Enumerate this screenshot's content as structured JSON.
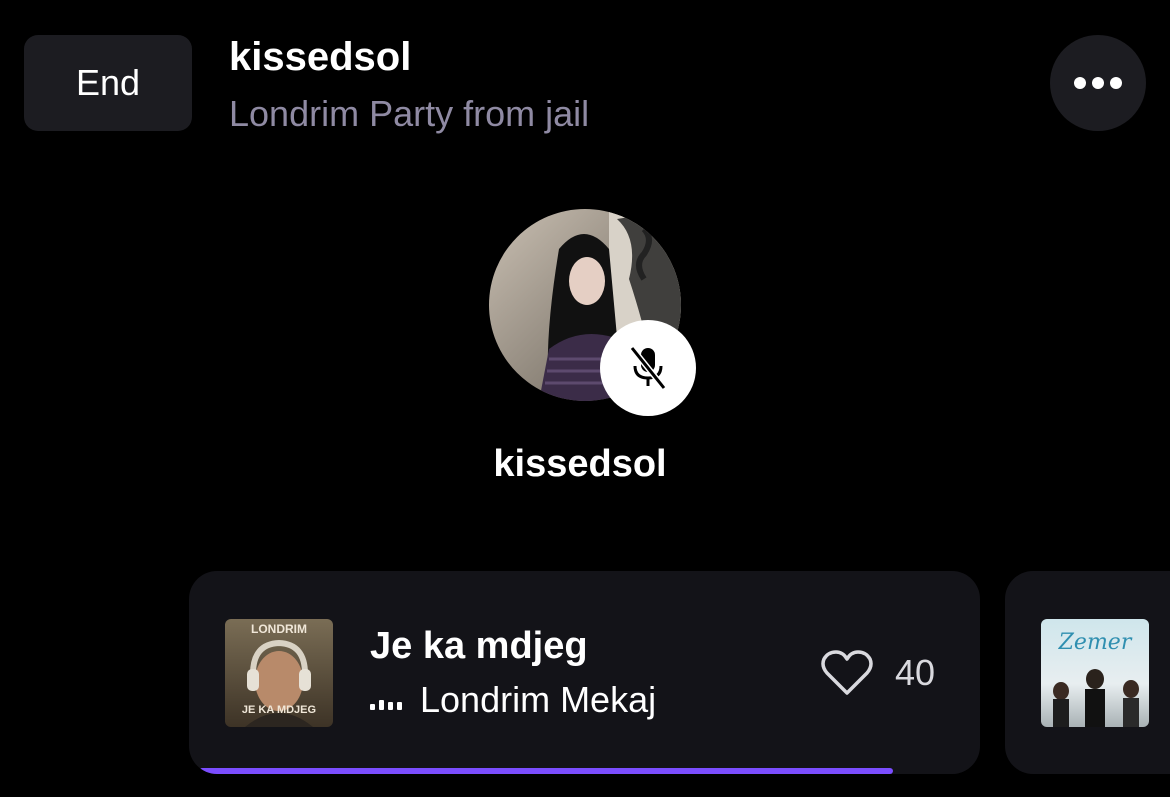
{
  "header": {
    "end_label": "End",
    "room_host": "kissedsol",
    "room_title": "Londrim Party from jail",
    "more_icon": "more-horizontal-icon"
  },
  "host": {
    "name": "kissedsol",
    "mic_state_icon": "mic-off-icon"
  },
  "now_playing": {
    "title": "Je ka mdjeg",
    "artist": "Londrim Mekaj",
    "like_count": "40",
    "progress": 0.9,
    "album_art": {
      "top_text": "LONDRIM",
      "bottom_text": "JE KA MDJEG"
    }
  },
  "up_next": {
    "album_art": {
      "script_text": "Zemer"
    }
  },
  "colors": {
    "background": "#000000",
    "surface": "#1c1c21",
    "card": "#131318",
    "accent_progress": "#7b4dff",
    "subtitle": "#8f8aa3"
  }
}
